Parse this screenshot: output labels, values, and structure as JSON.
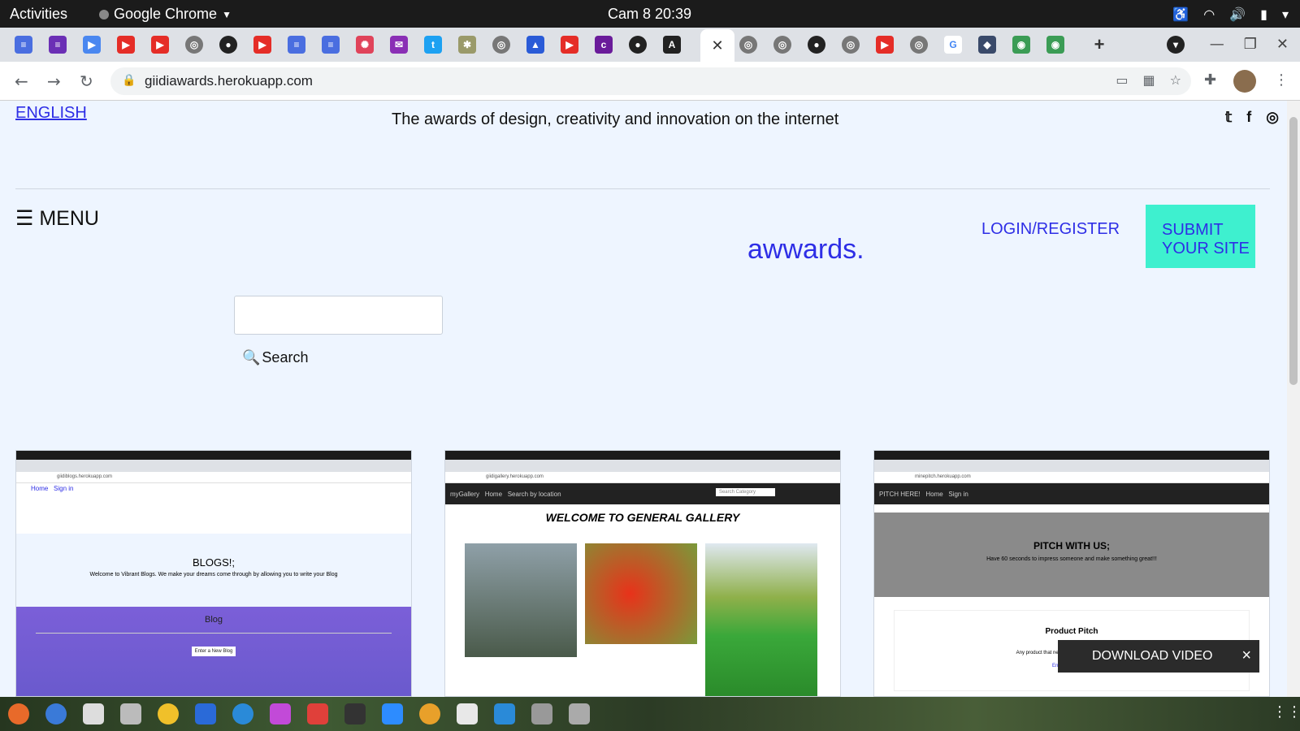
{
  "system_bar": {
    "activities": "Activities",
    "app_name": "Google Chrome",
    "clock": "Cam 8  20:39"
  },
  "browser": {
    "url": "giidiawards.herokuapp.com"
  },
  "page": {
    "language_link": "ENGLISH",
    "tagline": "The awards of design, creativity and innovation on the internet",
    "menu_label": "☰ MENU",
    "logo": "awwards.",
    "login_link": "LOGIN/REGISTER",
    "submit_button": "SUBMIT YOUR SITE",
    "search_button": "Search",
    "search_placeholder": ""
  },
  "cards": [
    {
      "url": "giidiblogs.herokuapp.com",
      "nav": [
        "Home",
        "Sign in"
      ],
      "heading": "BLOGS!;",
      "text": "Welcome to Vibrant Blogs. We make your dreams come through by allowing you to write your Blog",
      "band_title": "Blog",
      "band_button": "Enter a New Blog"
    },
    {
      "url": "giidigallery.herokuapp.com",
      "nav": [
        "myGallery",
        "Home",
        "Search by location"
      ],
      "search_placeholder": "Search Category",
      "heading": "WELCOME TO GENERAL GALLERY"
    },
    {
      "url": "minepitch.herokuapp.com",
      "nav": [
        "PITCH HERE!",
        "Home",
        "Sign in"
      ],
      "heading": "PITCH WITH US;",
      "text": "Have 60 seconds to impress someone and make something great!!!",
      "sub_title": "Product Pitch",
      "sub_text": "Any product that needs a manual to work is broken.",
      "sub_link": "Enter a New Pitch"
    }
  ],
  "download_overlay": {
    "label": "DOWNLOAD VIDEO",
    "close": "×"
  },
  "colors": {
    "accent_blue": "#2e2ee6",
    "submit_bg": "#3ef0cf",
    "page_bg": "#eef5ff"
  }
}
